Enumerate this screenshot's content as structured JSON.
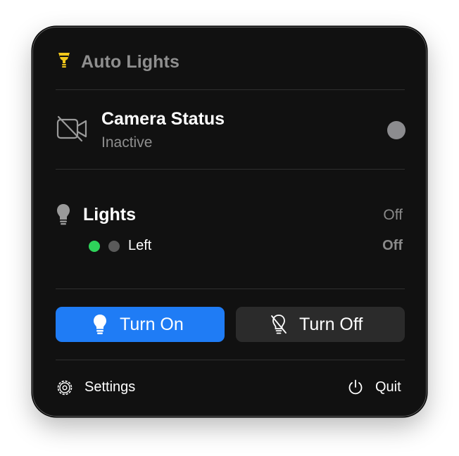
{
  "header": {
    "title": "Auto Lights",
    "icon": "lightbulb-icon",
    "icon_color": "#f2c81b"
  },
  "camera": {
    "title": "Camera Status",
    "status": "Inactive",
    "icon": "camera-off-icon",
    "indicator_color": "#8c8c8f"
  },
  "lights": {
    "title": "Lights",
    "state": "Off",
    "icon": "lightbulb-icon",
    "devices": [
      {
        "name": "Left",
        "state": "Off",
        "reachable_color": "#2ed35a",
        "power_color": "#5a5a5a"
      }
    ]
  },
  "actions": {
    "turn_on_label": "Turn On",
    "turn_off_label": "Turn Off",
    "accent_color": "#1f7cf5"
  },
  "footer": {
    "settings_label": "Settings",
    "quit_label": "Quit"
  }
}
